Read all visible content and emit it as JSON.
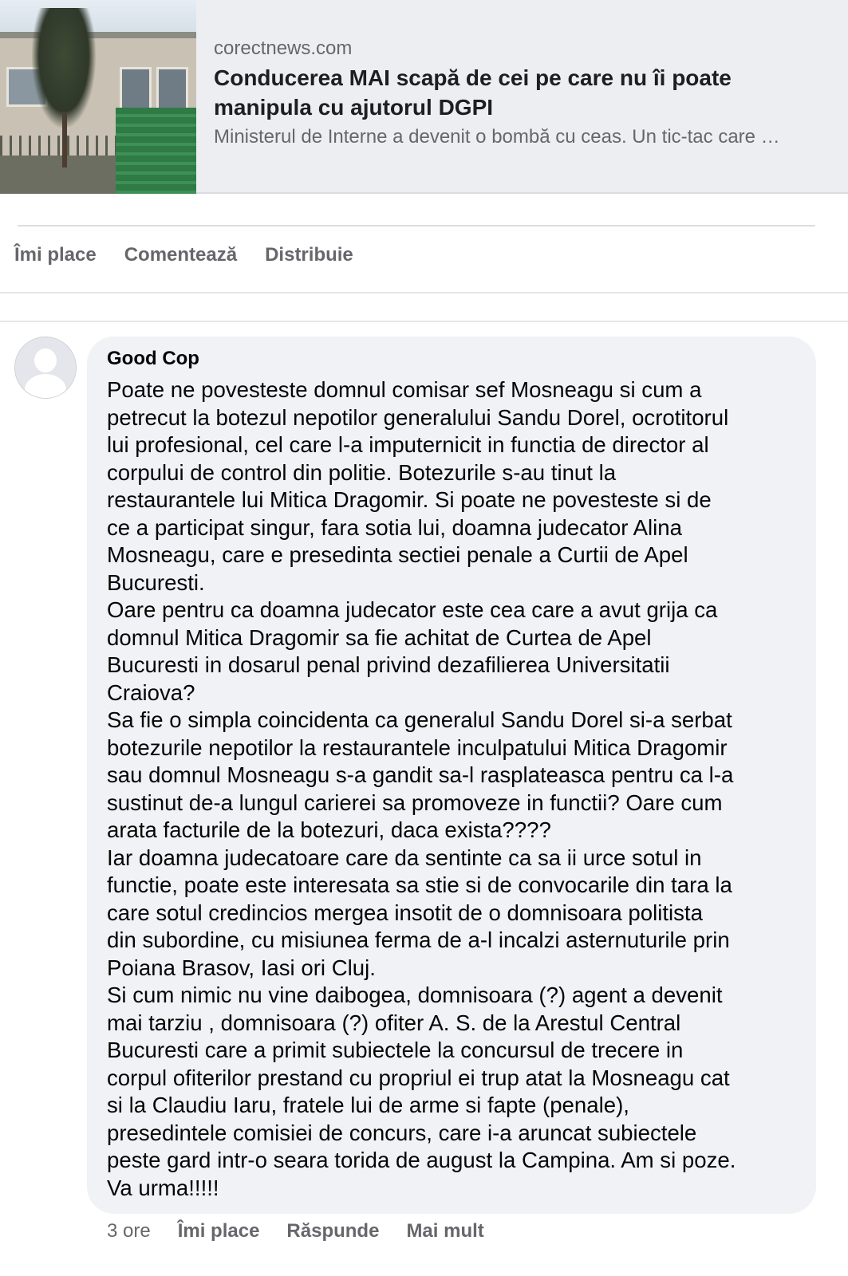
{
  "link_preview": {
    "domain": "corectnews.com",
    "headline": "Conducerea MAI scapă de cei pe care nu îi poate manipula cu ajutorul DGPI",
    "excerpt": "Ministerul de Interne a devenit o bombă cu ceas. Un tic-tac care …"
  },
  "post_actions": {
    "like": "Îmi place",
    "comment": "Comentează",
    "share": "Distribuie"
  },
  "comment": {
    "author": "Good Cop",
    "lines": [
      "Poate ne povesteste domnul comisar sef Mosneagu si cum a",
      "petrecut la botezul nepotilor generalului Sandu Dorel, ocrotitorul",
      "lui profesional, cel care l-a imputernicit in functia de director al",
      "corpului de control din politie. Botezurile s-au tinut la",
      "restaurantele lui Mitica Dragomir. Si poate ne povesteste si de",
      "ce a participat singur, fara sotia lui, doamna judecator Alina",
      "Mosneagu, care e presedinta sectiei penale a Curtii de Apel",
      "Bucuresti.",
      "Oare pentru ca doamna judecator este cea care a avut grija ca",
      "domnul Mitica Dragomir sa fie achitat de Curtea de Apel",
      "Bucuresti in dosarul penal privind dezafilierea Universitatii",
      "Craiova?",
      "Sa fie o simpla coincidenta ca generalul Sandu Dorel si-a serbat",
      "botezurile nepotilor la restaurantele inculpatului Mitica Dragomir",
      "sau domnul Mosneagu s-a gandit sa-l rasplateasca pentru ca l-a",
      "sustinut de-a lungul carierei sa promoveze in functii? Oare cum",
      "arata facturile de la botezuri, daca exista????",
      "Iar doamna judecatoare care da sentinte ca sa ii urce sotul in",
      "functie, poate este interesata sa stie si de convocarile din tara la",
      "care sotul credincios mergea insotit de o domnisoara politista",
      "din subordine, cu misiunea ferma de a-l incalzi asternuturile prin",
      "Poiana Brasov, Iasi ori Cluj.",
      "Si cum nimic nu vine daibogea, domnisoara (?) agent a devenit",
      "mai tarziu , domnisoara (?) ofiter A. S. de la Arestul Central",
      "Bucuresti care a primit subiectele la concursul de trecere in",
      "corpul ofiterilor prestand cu propriul ei trup atat la Mosneagu cat",
      "si la Claudiu Iaru, fratele lui de arme si fapte (penale),",
      "presedintele comisiei de concurs, care i-a aruncat subiectele",
      "peste gard intr-o seara torida de august la Campina. Am si poze.",
      "Va urma!!!!!"
    ],
    "time": "3 ore",
    "like": "Îmi place",
    "reply": "Răspunde",
    "more": "Mai mult"
  },
  "colors": {
    "card_bg": "#eceef1",
    "bubble_bg": "#f0f2f5",
    "secondary_text": "#65676b",
    "primary_text": "#050505"
  }
}
